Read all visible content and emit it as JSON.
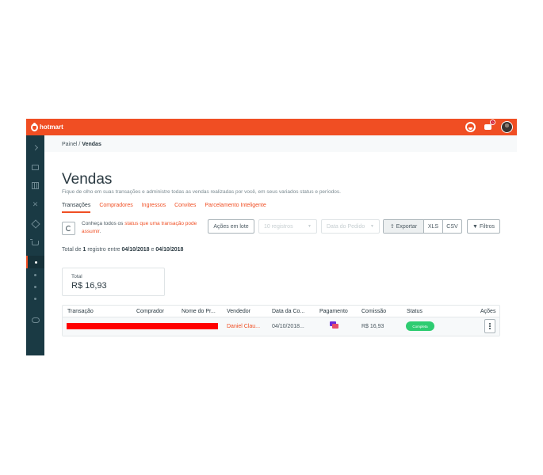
{
  "topbar": {
    "logo": "hotmart",
    "notification_count": "9"
  },
  "breadcrumb": {
    "parent": "Painel",
    "separator": "/",
    "current": "Vendas"
  },
  "page": {
    "title": "Vendas",
    "subtitle": "Fique de olho em suas transações e administre todas as vendas realizadas por você, em seus variados status e períodos."
  },
  "tabs": [
    "Transações",
    "Compradores",
    "Ingressos",
    "Convites",
    "Parcelamento Inteligente"
  ],
  "hint": {
    "prefix": "Conheça todos os ",
    "link": "status que uma transação pode assumir",
    "suffix": "."
  },
  "toolbar": {
    "bulk_actions": "Ações em lote",
    "per_page": "10 registros",
    "date_filter": "Data do Pedido",
    "export": "Exportar",
    "xls": "XLS",
    "csv": "CSV",
    "filters": "Filtros"
  },
  "summary": {
    "prefix": "Total de ",
    "count": "1",
    "middle": " registro entre ",
    "start": "04/10/2018",
    "and": " e ",
    "end": "04/10/2018"
  },
  "card": {
    "label": "Total",
    "value": "R$ 16,93"
  },
  "table": {
    "headers": [
      "Transação",
      "Comprador",
      "Nome do Pr...",
      "Vendedor",
      "Data da Co...",
      "Pagamento",
      "Comissão",
      "Status",
      "Ações"
    ],
    "rows": [
      {
        "seller": "Daniel Clau...",
        "date": "04/10/2018...",
        "commission": "R$ 16,93",
        "status": "Completa"
      }
    ]
  },
  "colors": {
    "brand": "#f04e23",
    "sidebar": "#1a3a44",
    "status_ok": "#2ecc71"
  }
}
